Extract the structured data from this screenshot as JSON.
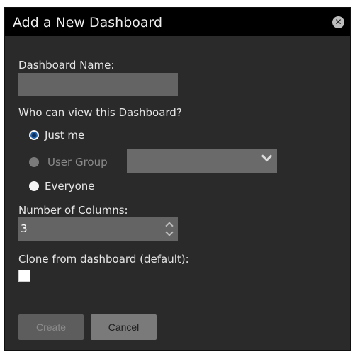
{
  "dialog": {
    "title": "Add a New Dashboard",
    "close_glyph": "✕"
  },
  "form": {
    "name_label": "Dashboard Name:",
    "name_value": "",
    "visibility_label": "Who can view this Dashboard?",
    "options": [
      {
        "label": "Just me",
        "checked": true,
        "disabled": false
      },
      {
        "label": "User Group",
        "checked": false,
        "disabled": true
      },
      {
        "label": "Everyone",
        "checked": false,
        "disabled": false
      }
    ],
    "user_group_selected": "",
    "columns_label": "Number of Columns:",
    "columns_value": "3",
    "clone_label": "Clone from dashboard (default):",
    "clone_checked": false
  },
  "buttons": {
    "create_label": "Create",
    "cancel_label": "Cancel"
  },
  "icons": {
    "close": "close-icon",
    "select": "chevron-down-icon",
    "spinner_up": "chevron-up-icon",
    "spinner_down": "chevron-down-icon"
  }
}
